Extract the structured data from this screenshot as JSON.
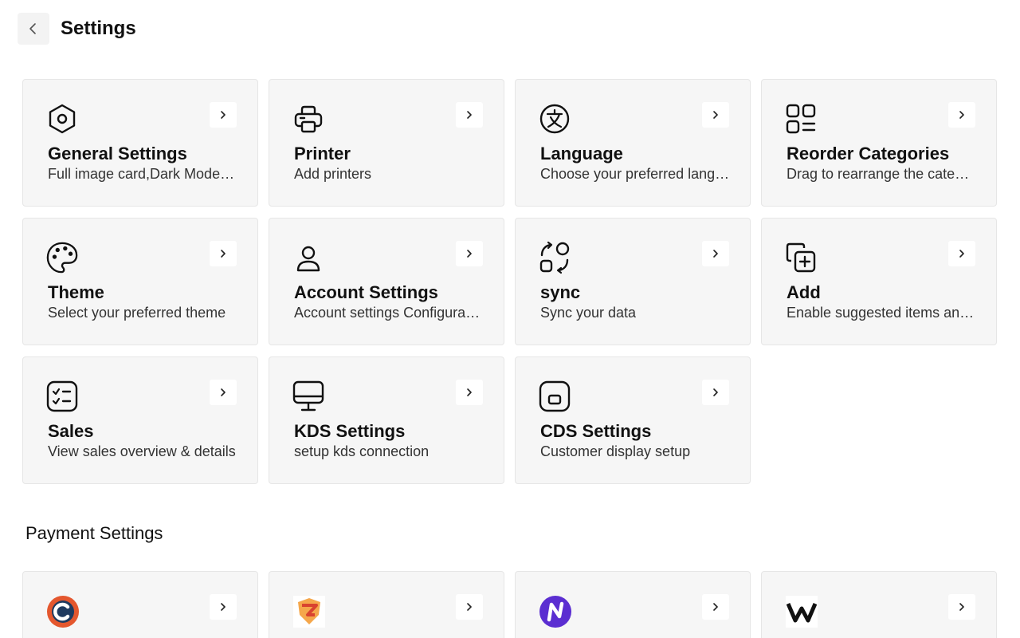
{
  "header": {
    "title": "Settings",
    "back_icon": "chevron-left-icon"
  },
  "cards": [
    {
      "title": "General Settings",
      "desc": "Full image card,Dark Mode and more",
      "icon": "hexagon-settings-icon"
    },
    {
      "title": "Printer",
      "desc": "Add printers",
      "icon": "printer-icon"
    },
    {
      "title": "Language",
      "desc": "Choose your preferred language",
      "icon": "language-icon"
    },
    {
      "title": "Reorder Categories",
      "desc": "Drag to rearrange the categories",
      "icon": "grid-list-icon"
    },
    {
      "title": "Theme",
      "desc": "Select your preferred theme",
      "icon": "palette-icon"
    },
    {
      "title": "Account Settings",
      "desc": "Account settings Configuration",
      "icon": "user-icon"
    },
    {
      "title": "sync",
      "desc": "Sync your data",
      "icon": "sync-icon"
    },
    {
      "title": "Add",
      "desc": "Enable suggested items and more",
      "icon": "add-copy-icon"
    },
    {
      "title": "Sales",
      "desc": "View sales overview & details",
      "icon": "checklist-icon"
    },
    {
      "title": "KDS Settings",
      "desc": "setup kds connection",
      "icon": "monitor-icon"
    },
    {
      "title": "CDS Settings",
      "desc": "Customer display setup",
      "icon": "customer-display-icon"
    }
  ],
  "payment": {
    "title": "Payment Settings",
    "providers": [
      {
        "icon": "provider-c-logo-icon",
        "color": "#e4572e"
      },
      {
        "icon": "provider-shield-logo-icon",
        "color": "#f0883e"
      },
      {
        "icon": "provider-n-logo-icon",
        "color": "#5b2ed1"
      },
      {
        "icon": "provider-w-logo-icon",
        "color": "#111111"
      }
    ]
  },
  "colors": {
    "card_bg": "#f6f6f6",
    "card_border": "#e6e6e6",
    "text": "#111111"
  }
}
